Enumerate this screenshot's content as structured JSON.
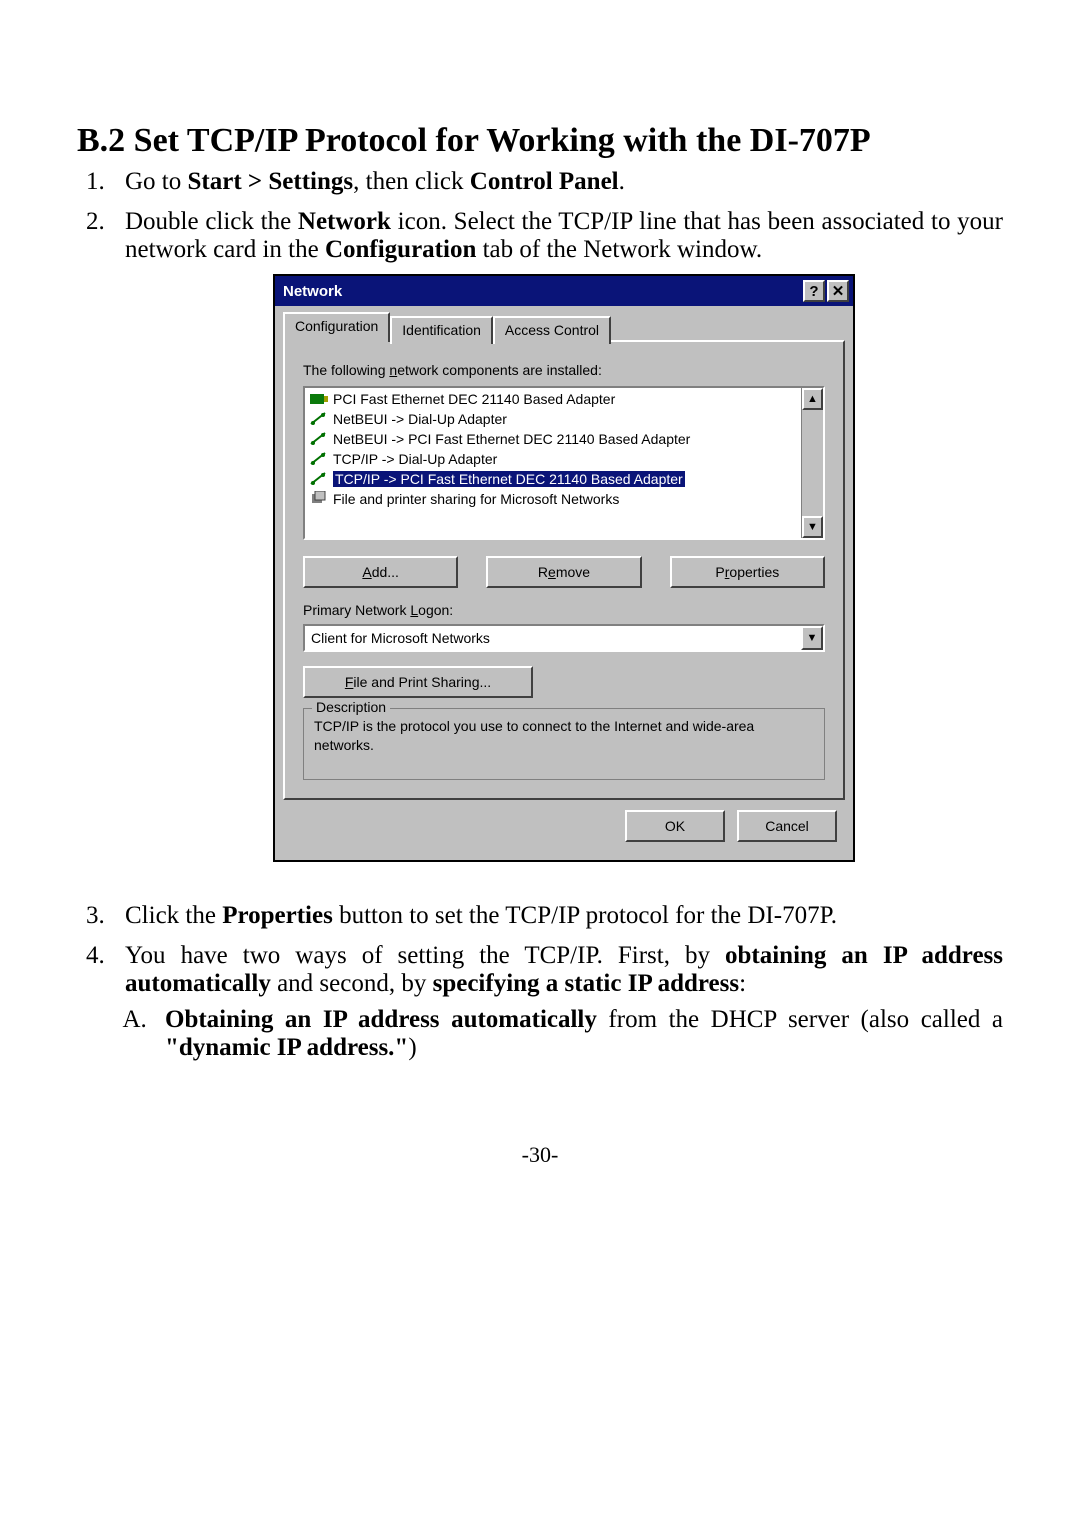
{
  "heading": "B.2 Set TCP/IP Protocol for Working with the DI-707P",
  "steps": {
    "s1_a": "Go to ",
    "s1_b": "Start > Settings",
    "s1_c": ", then click ",
    "s1_d": "Control Panel",
    "s1_e": ".",
    "s2_a": "Double click the ",
    "s2_b": "Network",
    "s2_c": " icon. Select the TCP/IP line that has been associated to your network card in the ",
    "s2_d": "Configuration",
    "s2_e": " tab of the Network window.",
    "s3_a": "Click the ",
    "s3_b": "Properties",
    "s3_c": " button to set the TCP/IP protocol for the DI-707P.",
    "s4_a": "You have two ways of setting the TCP/IP. First, by ",
    "s4_b": "obtaining an IP address automatically",
    "s4_c": " and second, by ",
    "s4_d": "specifying a static IP address",
    "s4_e": ":",
    "s4A_a": "Obtaining an IP address automatically",
    "s4A_b": " from the DHCP server (also called a ",
    "s4A_c": "\"dynamic IP address.\"",
    "s4A_d": ")"
  },
  "dialog": {
    "title": "Network",
    "help_glyph": "?",
    "close_glyph": "✕",
    "tabs": [
      "Configuration",
      "Identification",
      "Access Control"
    ],
    "components_label": "The following network components are installed:",
    "components": [
      "PCI Fast Ethernet DEC 21140 Based Adapter",
      "NetBEUI -> Dial-Up Adapter",
      "NetBEUI -> PCI Fast Ethernet DEC 21140 Based Adapter",
      "TCP/IP -> Dial-Up Adapter",
      "TCP/IP -> PCI Fast Ethernet DEC 21140 Based Adapter",
      "File and printer sharing for Microsoft Networks"
    ],
    "selected_index": 4,
    "add_label": "Add...",
    "remove_label": "Remove",
    "properties_label": "Properties",
    "primary_logon_label": "Primary Network Logon:",
    "primary_logon_value": "Client for Microsoft Networks",
    "file_share_label": "File and Print Sharing...",
    "description_legend": "Description",
    "description_text": "TCP/IP is the protocol you use to connect to the Internet and wide-area networks.",
    "ok": "OK",
    "cancel": "Cancel",
    "scroll_up": "▲",
    "scroll_down": "▼",
    "dd_glyph": "▼"
  },
  "page_number": "-30-"
}
